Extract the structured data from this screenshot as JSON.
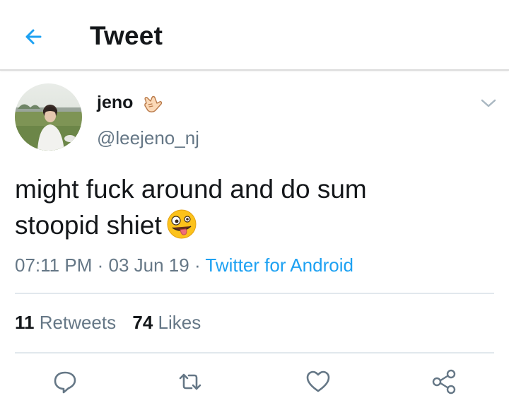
{
  "header": {
    "title": "Tweet",
    "back_icon": "arrow-left-icon",
    "accent": "#1da1f2"
  },
  "tweet": {
    "author": {
      "display_name": "jeno",
      "name_emoji": "call-me-hand-emoji",
      "handle": "@leejeno_nj"
    },
    "text_lines": [
      "might fuck around and do sum",
      "stoopid shiet"
    ],
    "text_emoji": "zany-face-emoji",
    "time": "07:11 PM",
    "sep1": "·",
    "date": "03 Jun 19",
    "sep2": "·",
    "source": "Twitter for Android"
  },
  "stats": {
    "retweets_count": "11",
    "retweets_label": "Retweets",
    "likes_count": "74",
    "likes_label": "Likes"
  },
  "actions": [
    {
      "name": "reply",
      "icon": "reply-icon"
    },
    {
      "name": "retweet",
      "icon": "retweet-icon"
    },
    {
      "name": "like",
      "icon": "heart-icon"
    },
    {
      "name": "share",
      "icon": "share-icon"
    }
  ],
  "colors": {
    "text_primary": "#14171a",
    "text_secondary": "#657786",
    "link": "#1da1f2",
    "divider": "#e1e8ed"
  }
}
